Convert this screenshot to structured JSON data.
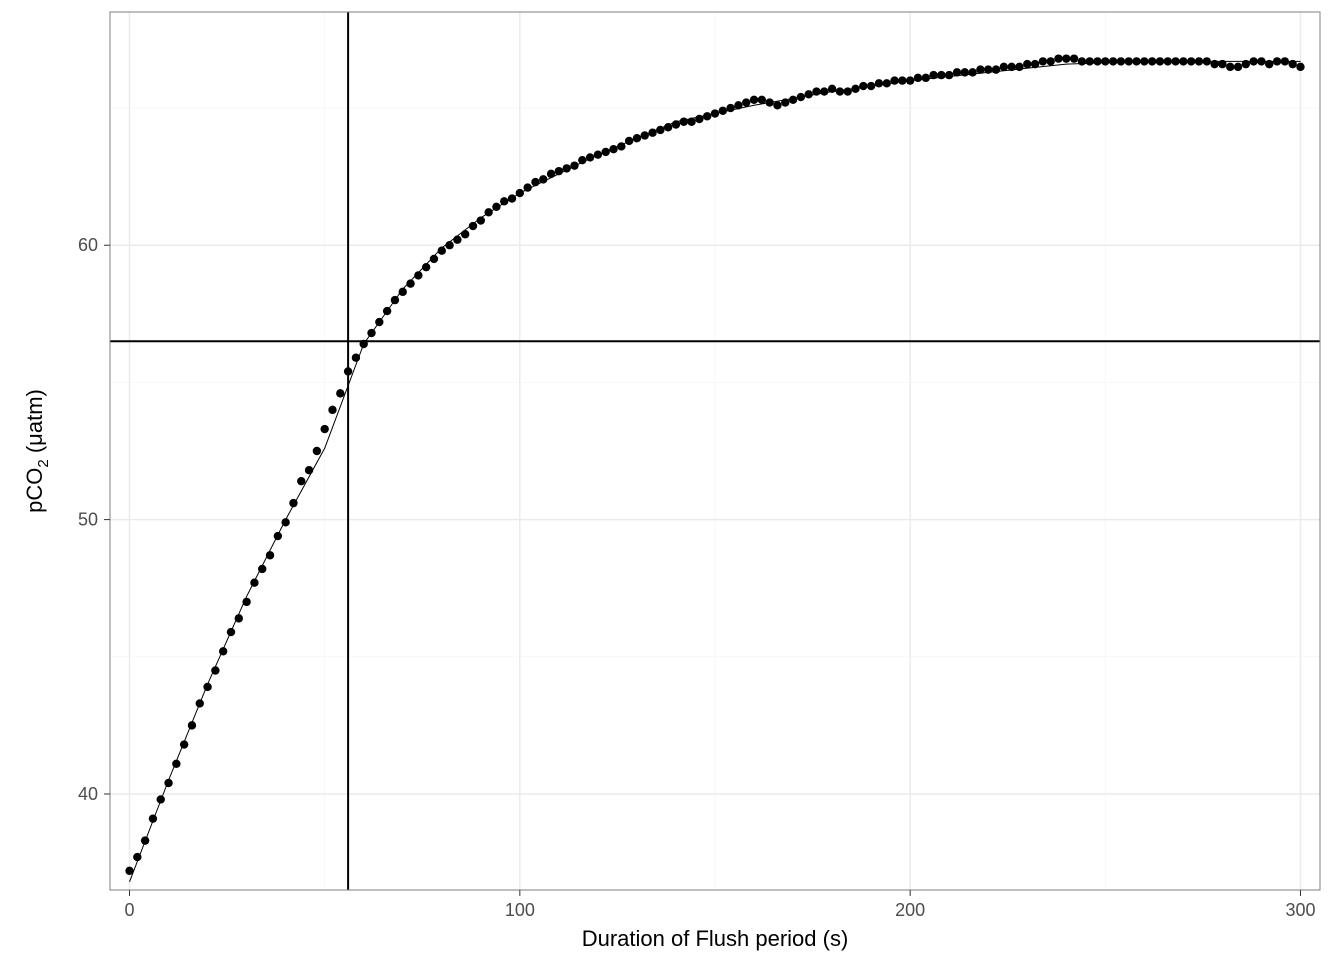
{
  "chart_data": {
    "type": "scatter",
    "title": "",
    "xlabel": "Duration of Flush period (s)",
    "ylabel_html": "pCO<tspan baseline-shift='-4' font-size='14'>2</tspan> (μatm)",
    "ylabel_plain": "pCO2 (μatm)",
    "xlim": [
      -5,
      305
    ],
    "ylim": [
      36.5,
      68.5
    ],
    "x_ticks": [
      0,
      100,
      200,
      300
    ],
    "y_ticks": [
      40,
      50,
      60
    ],
    "hline": 56.5,
    "vline": 56,
    "grid": true,
    "legend": false,
    "x": [
      0,
      2,
      4,
      6,
      8,
      10,
      12,
      14,
      16,
      18,
      20,
      22,
      24,
      26,
      28,
      30,
      32,
      34,
      36,
      38,
      40,
      42,
      44,
      46,
      48,
      50,
      52,
      54,
      56,
      58,
      60,
      62,
      64,
      66,
      68,
      70,
      72,
      74,
      76,
      78,
      80,
      82,
      84,
      86,
      88,
      90,
      92,
      94,
      96,
      98,
      100,
      102,
      104,
      106,
      108,
      110,
      112,
      114,
      116,
      118,
      120,
      122,
      124,
      126,
      128,
      130,
      132,
      134,
      136,
      138,
      140,
      142,
      144,
      146,
      148,
      150,
      152,
      154,
      156,
      158,
      160,
      162,
      164,
      166,
      168,
      170,
      172,
      174,
      176,
      178,
      180,
      182,
      184,
      186,
      188,
      190,
      192,
      194,
      196,
      198,
      200,
      202,
      204,
      206,
      208,
      210,
      212,
      214,
      216,
      218,
      220,
      222,
      224,
      226,
      228,
      230,
      232,
      234,
      236,
      238,
      240,
      242,
      244,
      246,
      248,
      250,
      252,
      254,
      256,
      258,
      260,
      262,
      264,
      266,
      268,
      270,
      272,
      274,
      276,
      278,
      280,
      282,
      284,
      286,
      288,
      290,
      292,
      294,
      296,
      298,
      300
    ],
    "y": [
      37.2,
      37.7,
      38.3,
      39.1,
      39.8,
      40.4,
      41.1,
      41.8,
      42.5,
      43.3,
      43.9,
      44.5,
      45.2,
      45.9,
      46.4,
      47.0,
      47.7,
      48.2,
      48.7,
      49.4,
      49.9,
      50.6,
      51.4,
      51.8,
      52.5,
      53.3,
      54.0,
      54.6,
      55.4,
      55.9,
      56.4,
      56.8,
      57.2,
      57.6,
      58.0,
      58.3,
      58.6,
      58.9,
      59.2,
      59.5,
      59.8,
      60.0,
      60.2,
      60.4,
      60.7,
      60.9,
      61.2,
      61.4,
      61.6,
      61.7,
      61.9,
      62.1,
      62.3,
      62.4,
      62.6,
      62.7,
      62.8,
      62.9,
      63.1,
      63.2,
      63.3,
      63.4,
      63.5,
      63.6,
      63.8,
      63.9,
      64.0,
      64.1,
      64.2,
      64.3,
      64.4,
      64.5,
      64.5,
      64.6,
      64.7,
      64.8,
      64.9,
      65.0,
      65.1,
      65.2,
      65.3,
      65.3,
      65.2,
      65.1,
      65.2,
      65.3,
      65.4,
      65.5,
      65.6,
      65.6,
      65.7,
      65.6,
      65.6,
      65.7,
      65.8,
      65.8,
      65.9,
      65.9,
      66.0,
      66.0,
      66.0,
      66.1,
      66.1,
      66.2,
      66.2,
      66.2,
      66.3,
      66.3,
      66.3,
      66.4,
      66.4,
      66.4,
      66.5,
      66.5,
      66.5,
      66.6,
      66.6,
      66.7,
      66.7,
      66.8,
      66.8,
      66.8,
      66.7,
      66.7,
      66.7,
      66.7,
      66.7,
      66.7,
      66.7,
      66.7,
      66.7,
      66.7,
      66.7,
      66.7,
      66.7,
      66.7,
      66.7,
      66.7,
      66.7,
      66.6,
      66.6,
      66.5,
      66.5,
      66.6,
      66.7,
      66.7,
      66.6,
      66.7,
      66.7,
      66.6,
      66.5
    ],
    "fit_x": [
      0,
      10,
      20,
      30,
      40,
      50,
      60,
      70,
      80,
      90,
      100,
      120,
      140,
      160,
      180,
      200,
      220,
      240,
      260,
      280,
      300
    ],
    "fit_y": [
      36.8,
      40.5,
      44.0,
      47.2,
      50.0,
      52.6,
      56.4,
      58.4,
      59.9,
      61.0,
      61.9,
      63.3,
      64.5,
      65.1,
      65.6,
      66.0,
      66.3,
      66.6,
      66.7,
      66.7,
      66.7
    ]
  },
  "labels": {
    "x_tick_0": "0",
    "x_tick_100": "100",
    "x_tick_200": "200",
    "x_tick_300": "300",
    "y_tick_40": "40",
    "y_tick_50": "50",
    "y_tick_60": "60",
    "xlabel": "Duration of Flush period (s)",
    "ylabel": "pCO2 (μatm)"
  }
}
